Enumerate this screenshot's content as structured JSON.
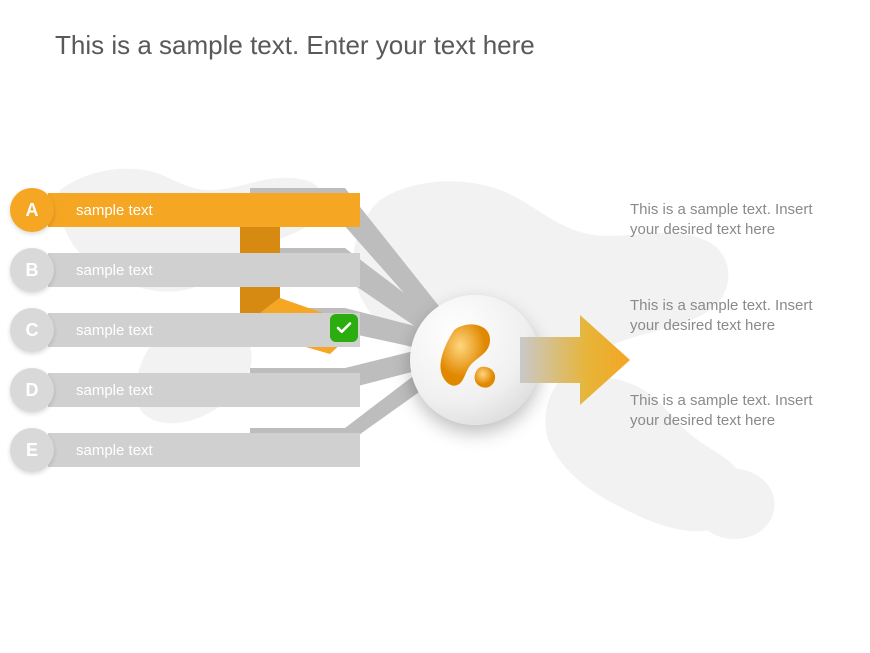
{
  "title": "This is a sample text. Enter your text here",
  "items": [
    {
      "letter": "A",
      "label": "sample text",
      "active": true
    },
    {
      "letter": "B",
      "label": "sample text",
      "active": false
    },
    {
      "letter": "C",
      "label": "sample text",
      "active": false
    },
    {
      "letter": "D",
      "label": "sample text",
      "active": false
    },
    {
      "letter": "E",
      "label": "sample text",
      "active": false
    }
  ],
  "descriptions": [
    "This is a sample text. Insert your desired text here",
    "This is a sample text. Insert your desired text here",
    "This is a sample text. Insert your desired text here"
  ],
  "colors": {
    "accent": "#f5a623",
    "muted": "#d0d0d0",
    "check": "#2bad0f",
    "text": "#8a8a8a"
  }
}
